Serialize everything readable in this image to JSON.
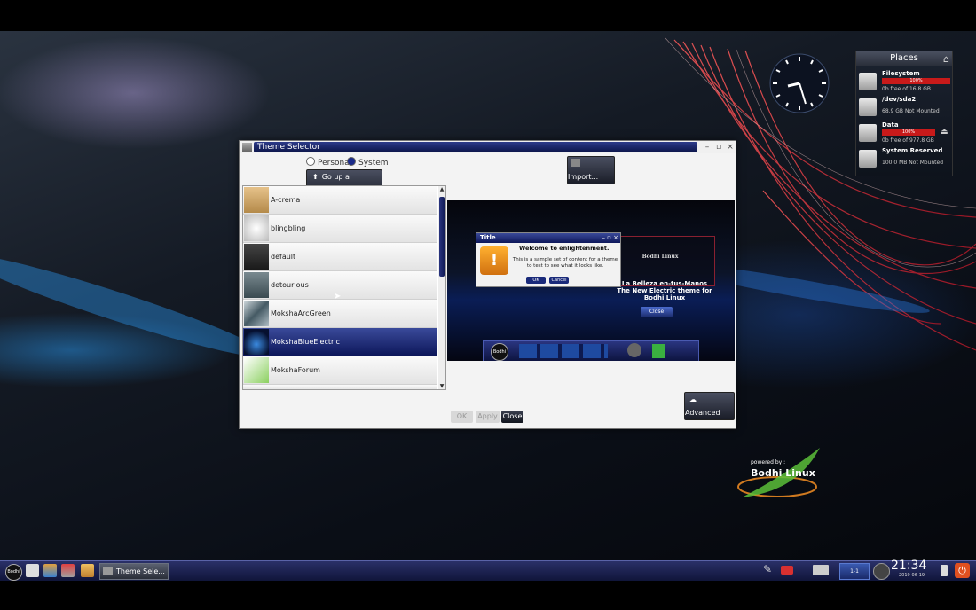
{
  "window": {
    "title": "Theme Selector",
    "controls": {
      "minimize": "–",
      "maximize": "▫",
      "close": "×"
    },
    "radio_personal": "Personal",
    "radio_system": "System",
    "selected_source": "System",
    "go_up_label": "Go up a Directory",
    "import_label": "Import...",
    "advanced_label": "Advanced",
    "ok_label": "OK",
    "apply_label": "Apply",
    "close_label": "Close"
  },
  "themes": [
    {
      "name": "A-crema",
      "color": "#c9a36a"
    },
    {
      "name": "blingbling",
      "color": "#d8d8d8"
    },
    {
      "name": "default",
      "color": "#2a2a2a"
    },
    {
      "name": "detourious",
      "color": "#5a6a70"
    },
    {
      "name": "MokshaArcGreen",
      "color": "#7a8a90"
    },
    {
      "name": "MokshaBlueElectric",
      "color": "#10204a",
      "selected": true
    },
    {
      "name": "MokshaForum",
      "color": "#7cc04a"
    }
  ],
  "preview": {
    "dialog_title": "Title",
    "dialog_heading": "Welcome to enlightenment.",
    "dialog_body": "This is a sample set of content for a theme to test to see what it looks like.",
    "dialog_ok": "OK",
    "dialog_cancel": "Cancel",
    "heading_line1": "Bodhi Linux",
    "heading_line2": "La Belleza en-tus-Manos",
    "heading_line3": "The New Electric theme for",
    "heading_line4": "Bodhi Linux",
    "close_label": "Close",
    "launcher_label": "Bodhi"
  },
  "places": {
    "title": "Places",
    "items": [
      {
        "name": "Filesystem",
        "bar": "100%",
        "info": "0b free of 16.8 GB",
        "usage": 1.0
      },
      {
        "name": "/dev/sda2",
        "bar": "",
        "info": "68.9 GB Not Mounted",
        "usage": 0
      },
      {
        "name": "Data",
        "bar": "100%",
        "info": "0b free of 977.8 GB",
        "usage": 1.0
      },
      {
        "name": "System Reserved",
        "bar": "",
        "info": "100.0 MB Not Mounted",
        "usage": 0
      }
    ]
  },
  "desktop_logo": {
    "small": "powered by :",
    "brand": "Bodhi Linux"
  },
  "taskbar": {
    "start_label": "Bodhi",
    "task_label": "Theme Sele...",
    "pager_label": "1-1",
    "time": "21:34",
    "date": "2019-06-19"
  }
}
